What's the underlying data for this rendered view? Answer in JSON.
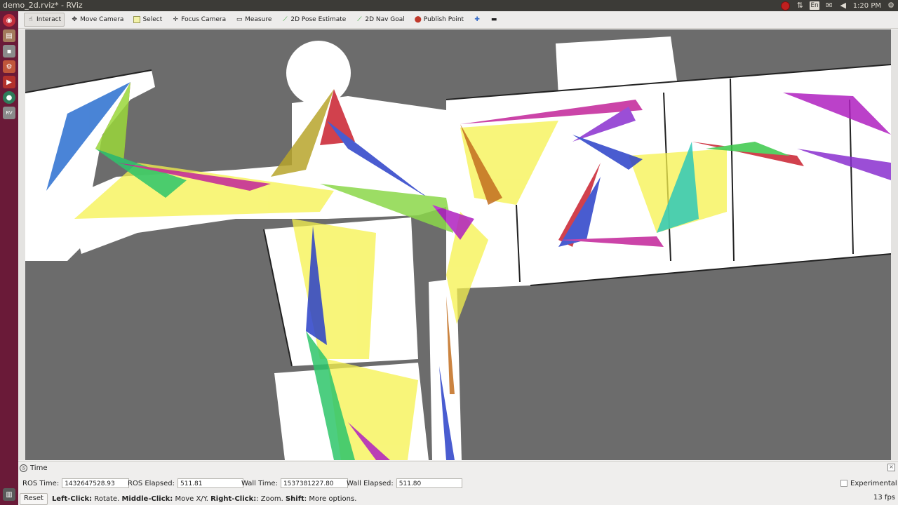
{
  "window": {
    "title": "demo_2d.rviz* - RViz"
  },
  "topbar": {
    "language": "En",
    "time": "1:20 PM"
  },
  "launcher": {
    "items": [
      "dash-icon",
      "files-icon",
      "terminal-icon",
      "settings-icon",
      "media-icon",
      "browser-icon",
      "rviz-icon"
    ]
  },
  "toolbar": {
    "tools": [
      {
        "label": "Interact",
        "icon": "cursor-icon",
        "active": true
      },
      {
        "label": "Move Camera",
        "icon": "move-camera-icon",
        "active": false
      },
      {
        "label": "Select",
        "icon": "select-icon",
        "active": false
      },
      {
        "label": "Focus Camera",
        "icon": "focus-camera-icon",
        "active": false
      },
      {
        "label": "Measure",
        "icon": "measure-icon",
        "active": false
      },
      {
        "label": "2D Pose Estimate",
        "icon": "pose-arrow-icon",
        "active": false
      },
      {
        "label": "2D Nav Goal",
        "icon": "nav-arrow-icon",
        "active": false
      },
      {
        "label": "Publish Point",
        "icon": "map-pin-icon",
        "active": false
      }
    ]
  },
  "time_panel": {
    "title": "Time",
    "ros_time_label": "ROS Time:",
    "ros_time": "1432647528.93",
    "ros_elapsed_label": "ROS Elapsed:",
    "ros_elapsed": "511.81",
    "wall_time_label": "Wall Time:",
    "wall_time": "1537381227.80",
    "wall_elapsed_label": "Wall Elapsed:",
    "wall_elapsed": "511.80",
    "experimental_label": "Experimental"
  },
  "status": {
    "reset_label": "Reset",
    "hint_left_click": "Left-Click:",
    "hint_rotate": " Rotate. ",
    "hint_middle_click": "Middle-Click:",
    "hint_move": " Move X/Y. ",
    "hint_right_click": "Right-Click:",
    "hint_zoom": ": Zoom. ",
    "hint_shift": "Shift",
    "hint_more": ": More options.",
    "fps": "13 fps"
  },
  "colors": {
    "map_free": "#ffffff",
    "map_unknown": "#6c6c6c",
    "launcher_bg": "#6a1a38",
    "panel_bg": "#3c3b37"
  }
}
